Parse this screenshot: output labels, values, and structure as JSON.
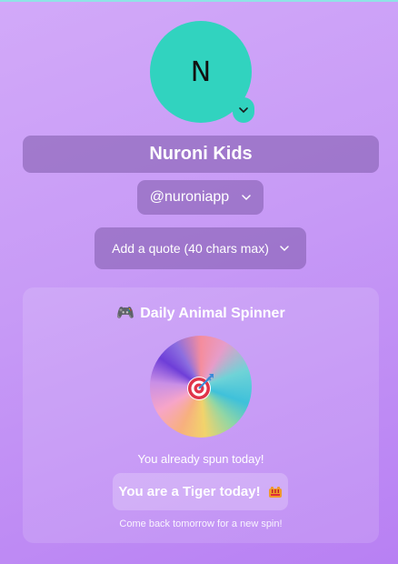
{
  "profile": {
    "avatar_initial": "N",
    "avatar_color": "#31d3bf",
    "name": "Nuroni Kids",
    "handle": "@nuroniapp",
    "quote_placeholder": "Add a quote (40 chars max)"
  },
  "spinner": {
    "title_icon": "game-controller-icon",
    "title_emoji": "🎮",
    "title": "Daily Animal Spinner",
    "wheel_icon": "target-icon",
    "status": "You already spun today!",
    "result": "You are a Tiger today!",
    "result_icon": "tiger-icon",
    "footnote": "Come back tomorrow for a new spin!"
  },
  "colors": {
    "background": "#c79af6",
    "accent": "#31d3bf",
    "pill": "#8e64b8"
  }
}
